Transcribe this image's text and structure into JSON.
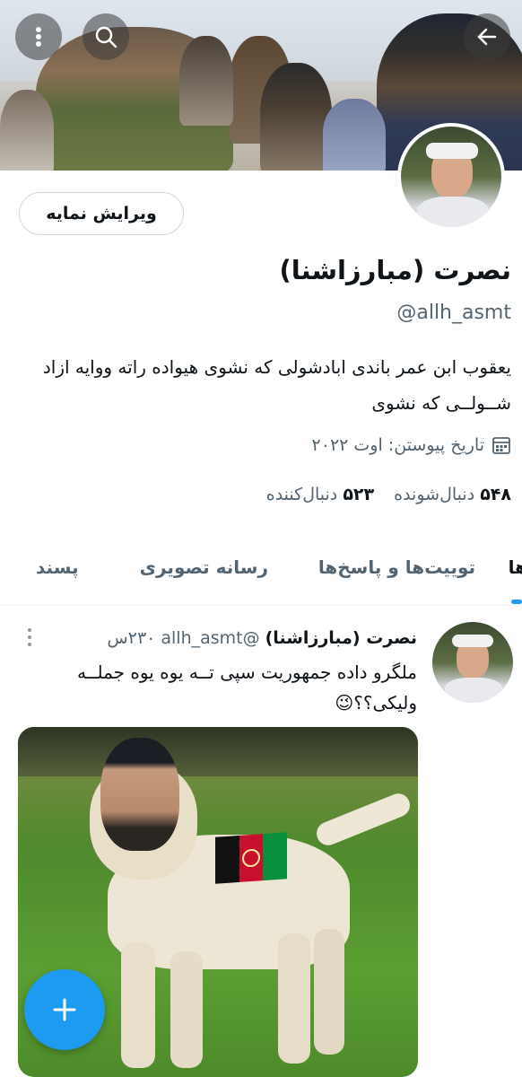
{
  "profile": {
    "edit_button": "ویرایش نمایه",
    "display_name": "نصرت (مبارزاشنا)",
    "handle": "@allh_asmt",
    "bio": "یعقوب ابن عمر باندی ابادشولی که نشوی  هیواده راته ووایه ازاد شــولــی که نشوی",
    "joined": "تاریخ پیوستن: اوت ۲۰۲۲",
    "following_count": "۵۴۸",
    "following_label": "دنبال‌شونده",
    "followers_count": "۵۲۳",
    "followers_label": "دنبال‌کننده"
  },
  "tabs": [
    {
      "label": "ها"
    },
    {
      "label": "توییت‌ها و پاسخ‌ها"
    },
    {
      "label": "رسانه تصویری"
    },
    {
      "label": "پسند"
    }
  ],
  "tweet": {
    "name": "نصرت (مبارزاشنا)",
    "handle": "@allh_asmt",
    "time": "۲۳۰س",
    "text": "ملگرو داده جمهوریت سپی تــه یوه یوه جملــه ولیکی؟؟😉"
  },
  "icons": {
    "back": "arrow-left-icon",
    "search": "search-icon",
    "more": "more-vertical-icon",
    "calendar": "calendar-icon",
    "compose": "plus-icon"
  },
  "colors": {
    "accent": "#1d9bf0",
    "text": "#0f1419",
    "muted": "#536471"
  }
}
